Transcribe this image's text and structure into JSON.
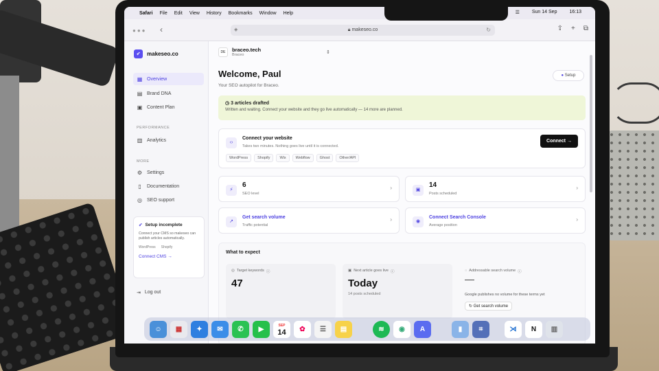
{
  "menubar": {
    "apple": "",
    "items": [
      "Safari",
      "File",
      "Edit",
      "View",
      "History",
      "Bookmarks",
      "Window",
      "Help"
    ],
    "date": "Sun 14 Sep",
    "time": "16:13"
  },
  "browser": {
    "url": "makeseo.co"
  },
  "sidebar": {
    "brand": "makeseo.co",
    "nav": [
      {
        "label": "Overview",
        "icon": "grid-icon"
      },
      {
        "label": "Brand DNA",
        "icon": "book-icon"
      },
      {
        "label": "Content Plan",
        "icon": "calendar-icon"
      }
    ],
    "section_performance": "PERFORMANCE",
    "analytics": "Analytics",
    "section_more": "MORE",
    "more_items": [
      "Settings",
      "Documentation",
      "SEO support"
    ],
    "setup_card": {
      "title": "Setup incomplete",
      "desc": "Connect your CMS so makeseo can publish articles automatically.",
      "platforms": [
        "WordPress",
        "Shopify"
      ],
      "cta": "Connect CMS →"
    },
    "logout": "Log out"
  },
  "project": {
    "avatar": "DE",
    "name": "braceo.tech",
    "sub": "Braceo"
  },
  "main": {
    "welcome": "Welcome, Paul",
    "tagline": "Your SEO autopilot for Braceo.",
    "setup_button": "Setup",
    "banner": {
      "title": "3 articles drafted",
      "desc": "Written and waiting. Connect your website and they go live automatically — 14 more are planned."
    },
    "connect": {
      "title": "Connect your website",
      "desc": "Takes two minutes. Nothing goes live until it is connected.",
      "button": "Connect →",
      "chips": [
        "WordPress",
        "Shopify",
        "Wix",
        "Webflow",
        "Ghost",
        "Other/API"
      ]
    },
    "stats": {
      "seo_value": "6",
      "seo_label": "SEO level",
      "posts_value": "14",
      "posts_label": "Posts scheduled",
      "search_link": "Get search volume",
      "search_label": "Traffic potential",
      "console_link": "Connect Search Console",
      "console_label": "Average position"
    },
    "expect": {
      "heading": "What to expect",
      "keywords_label": "Target keywords",
      "keywords_value": "47",
      "next_label": "Next article goes live",
      "next_value": "Today",
      "next_sub": "14 posts scheduled",
      "volume_label": "Addressable search volume",
      "volume_note": "Google publishes no volume for these terms yet",
      "volume_button": "Get search volume"
    }
  },
  "dock": {
    "calendar_month": "SEP",
    "calendar_day": "14"
  }
}
